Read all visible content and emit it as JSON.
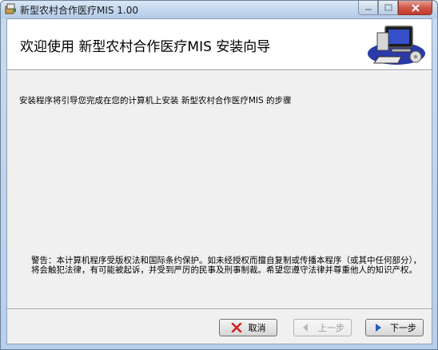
{
  "window": {
    "title": "新型农村合作医疗MIS 1.00"
  },
  "banner": {
    "heading": "欢迎使用 新型农村合作医疗MIS 安装向导",
    "image_icon": "computer-setup-icon"
  },
  "body": {
    "description": "安装程序将引导您完成在您的计算机上安装 新型农村合作医疗MIS 的步骤",
    "warning": "警告：本计算机程序受版权法和国际条约保护。如未经授权而擅自复制或传播本程序（或其中任何部分），将会触犯法律，有可能被起诉，并受到严厉的民事及刑事制裁。希望您遵守法律并尊重他人的知识产权。"
  },
  "buttons": {
    "cancel": "取消",
    "prev": "上一步",
    "next": "下一步"
  },
  "colors": {
    "cancel_icon": "#d42020",
    "next_icon": "#1f5fbf",
    "disabled_text": "#9a9a9a"
  }
}
